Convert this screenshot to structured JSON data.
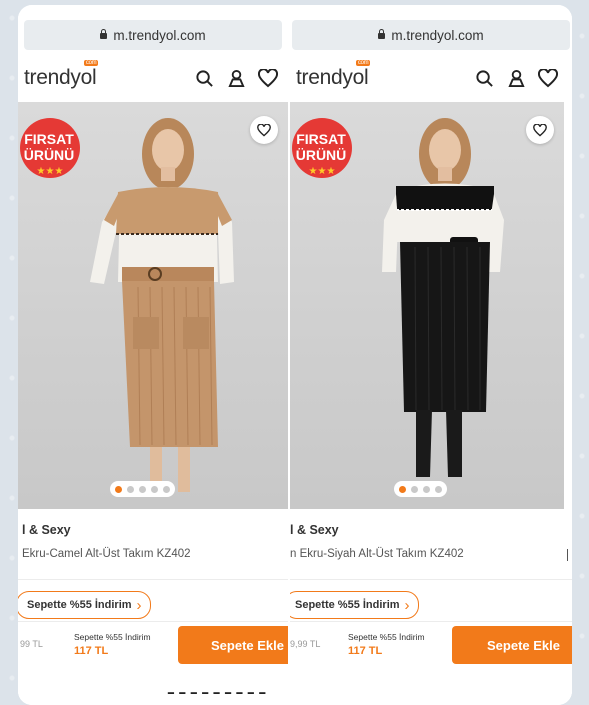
{
  "left": {
    "url": "m.trendyol.com",
    "logo": "trendyol",
    "logo_badge": "com",
    "badge_line1": "FIRSAT",
    "badge_line2": "ÜRÜNÜ",
    "title": "l & Sexy",
    "subtitle": "Ekru-Camel Alt-Üst Takım KZ402",
    "promo": "Sepette %55 İndirim",
    "old_price": "99 TL",
    "cart_promo": "Sepette %55 İndirim",
    "new_price": "117 TL",
    "add_button": "Sepete Ekle",
    "colors": {
      "top_band": "#c89a6e",
      "skirt": "#c4956b",
      "wall": "#d3d3d3"
    }
  },
  "right": {
    "url": "m.trendyol.com",
    "logo": "trendyol",
    "logo_badge": "com",
    "badge_line1": "FIRSAT",
    "badge_line2": "ÜRÜNÜ",
    "title": "l & Sexy",
    "subtitle": "n Ekru-Siyah Alt-Üst Takım KZ402",
    "promo": "Sepette %55 İndirim",
    "old_price": "9,99 TL",
    "cart_promo": "Sepette %55 İndirim",
    "new_price": "117 TL",
    "add_button": "Sepete Ekle",
    "colors": {
      "top_band": "#111111",
      "skirt": "#161616",
      "wall": "#d0d0d0"
    }
  },
  "caption": "ـ ـ ـ ـ ـ ـ ـ ـ ـ",
  "accent": "#f27a1a",
  "icons": [
    "lock-icon",
    "search-icon",
    "user-icon",
    "heart-icon",
    "favorite-icon",
    "chevron-right-icon"
  ]
}
